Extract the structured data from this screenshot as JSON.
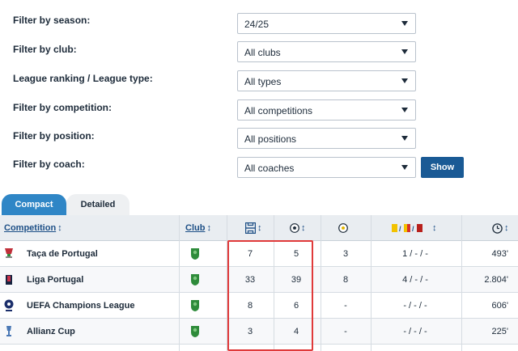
{
  "filters": {
    "season": {
      "label": "Filter by season:",
      "value": "24/25"
    },
    "club": {
      "label": "Filter by club:",
      "value": "All clubs"
    },
    "league": {
      "label": "League ranking / League type:",
      "value": "All types"
    },
    "competition": {
      "label": "Filter by competition:",
      "value": "All competitions"
    },
    "position": {
      "label": "Filter by position:",
      "value": "All positions"
    },
    "coach": {
      "label": "Filter by coach:",
      "value": "All coaches"
    },
    "show_label": "Show"
  },
  "tabs": {
    "compact": "Compact",
    "detailed": "Detailed"
  },
  "table": {
    "headers": {
      "competition": "Competition",
      "club": "Club",
      "sort": "↕"
    },
    "rows": [
      {
        "competition": "Taça de Portugal",
        "appearances": "7",
        "goals": "5",
        "assists": "3",
        "cards": "1 / - / -",
        "minutes": "493'"
      },
      {
        "competition": "Liga Portugal",
        "appearances": "33",
        "goals": "39",
        "assists": "8",
        "cards": "4 / - / -",
        "minutes": "2.804'"
      },
      {
        "competition": "UEFA Champions League",
        "appearances": "8",
        "goals": "6",
        "assists": "-",
        "cards": "- / - / -",
        "minutes": "606'"
      },
      {
        "competition": "Allianz Cup",
        "appearances": "3",
        "goals": "4",
        "assists": "-",
        "cards": "- / - / -",
        "minutes": "225'"
      }
    ]
  },
  "colors": {
    "accent": "#2f86c6",
    "button": "#1a5a95",
    "highlight": "#e03a3a",
    "club_green": "#2e8b3a"
  }
}
